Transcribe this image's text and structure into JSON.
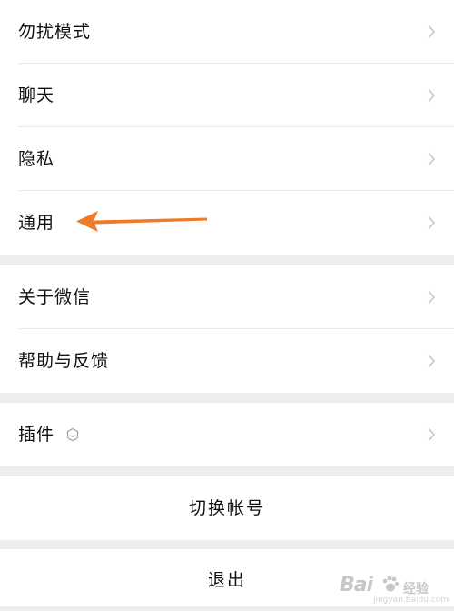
{
  "settings": {
    "group1": [
      {
        "label": "勿扰模式"
      },
      {
        "label": "聊天"
      },
      {
        "label": "隐私"
      },
      {
        "label": "通用"
      }
    ],
    "group2": [
      {
        "label": "关于微信"
      },
      {
        "label": "帮助与反馈"
      }
    ],
    "group3": [
      {
        "label": "插件"
      }
    ],
    "switch_account_label": "切换帐号",
    "logout_label": "退出"
  },
  "watermark": {
    "brand": "Bai",
    "suffix": "经验",
    "url": "jingyan.baidu.com"
  },
  "colors": {
    "arrow": "#f07a28",
    "background": "#ededed",
    "chevron": "#c7c7cc"
  }
}
